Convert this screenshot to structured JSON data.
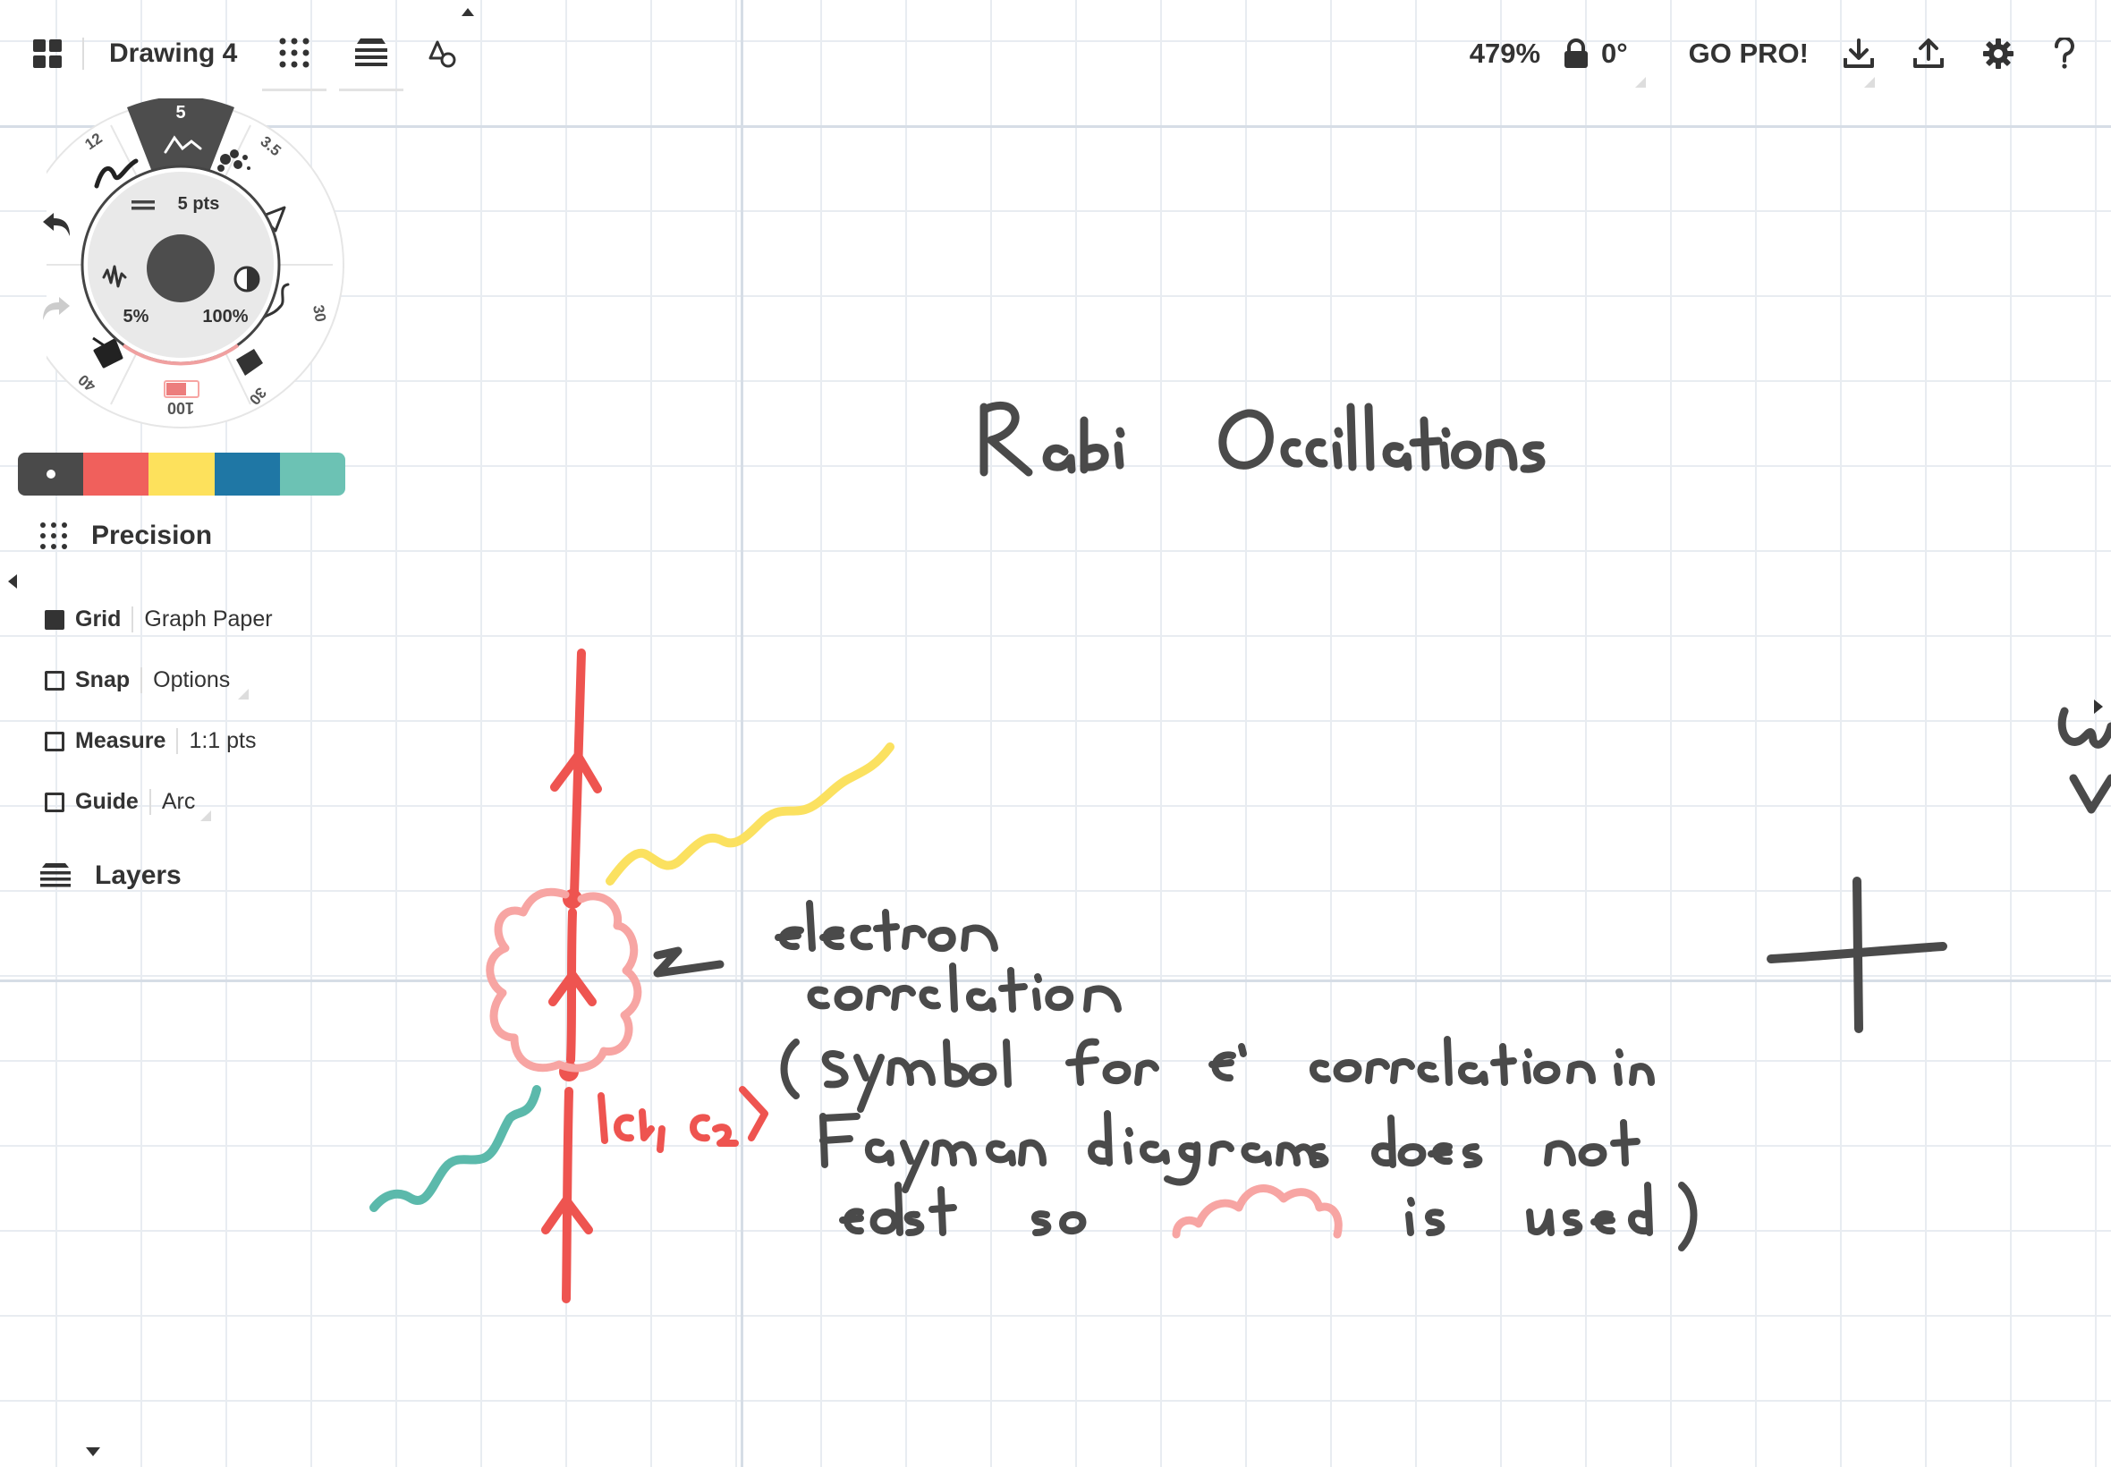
{
  "app": {
    "document_title": "Drawing 4"
  },
  "toolbar_right": {
    "zoom": "479%",
    "rotation": "0°",
    "go_pro": "GO PRO!"
  },
  "brush_wheel": {
    "active_size": "5",
    "size_12": "12",
    "size_35": "3.5",
    "size_30a": "30",
    "size_30b": "30",
    "size_40": "40",
    "size_100": "100",
    "stroke_width": "5 pts",
    "smoothing": "5%",
    "opacity": "100%"
  },
  "colors": {
    "swatches": [
      "#4a4a4a",
      "#f0605c",
      "#fde15c",
      "#1f77a5",
      "#6cc2b4"
    ],
    "ink_dark": "#4a4a4a",
    "ink_red": "#ee5450",
    "ink_pink": "#f7a5a3",
    "ink_yellow": "#fbe160",
    "ink_teal": "#5bb9ab"
  },
  "precision": {
    "title": "Precision",
    "rows": [
      {
        "key": "Grid",
        "value": "Graph Paper",
        "checked": true
      },
      {
        "key": "Snap",
        "value": "Options",
        "checked": false
      },
      {
        "key": "Measure",
        "value": "1:1 pts",
        "checked": false
      },
      {
        "key": "Guide",
        "value": "Arc",
        "checked": false
      }
    ]
  },
  "layers": {
    "title": "Layers"
  }
}
